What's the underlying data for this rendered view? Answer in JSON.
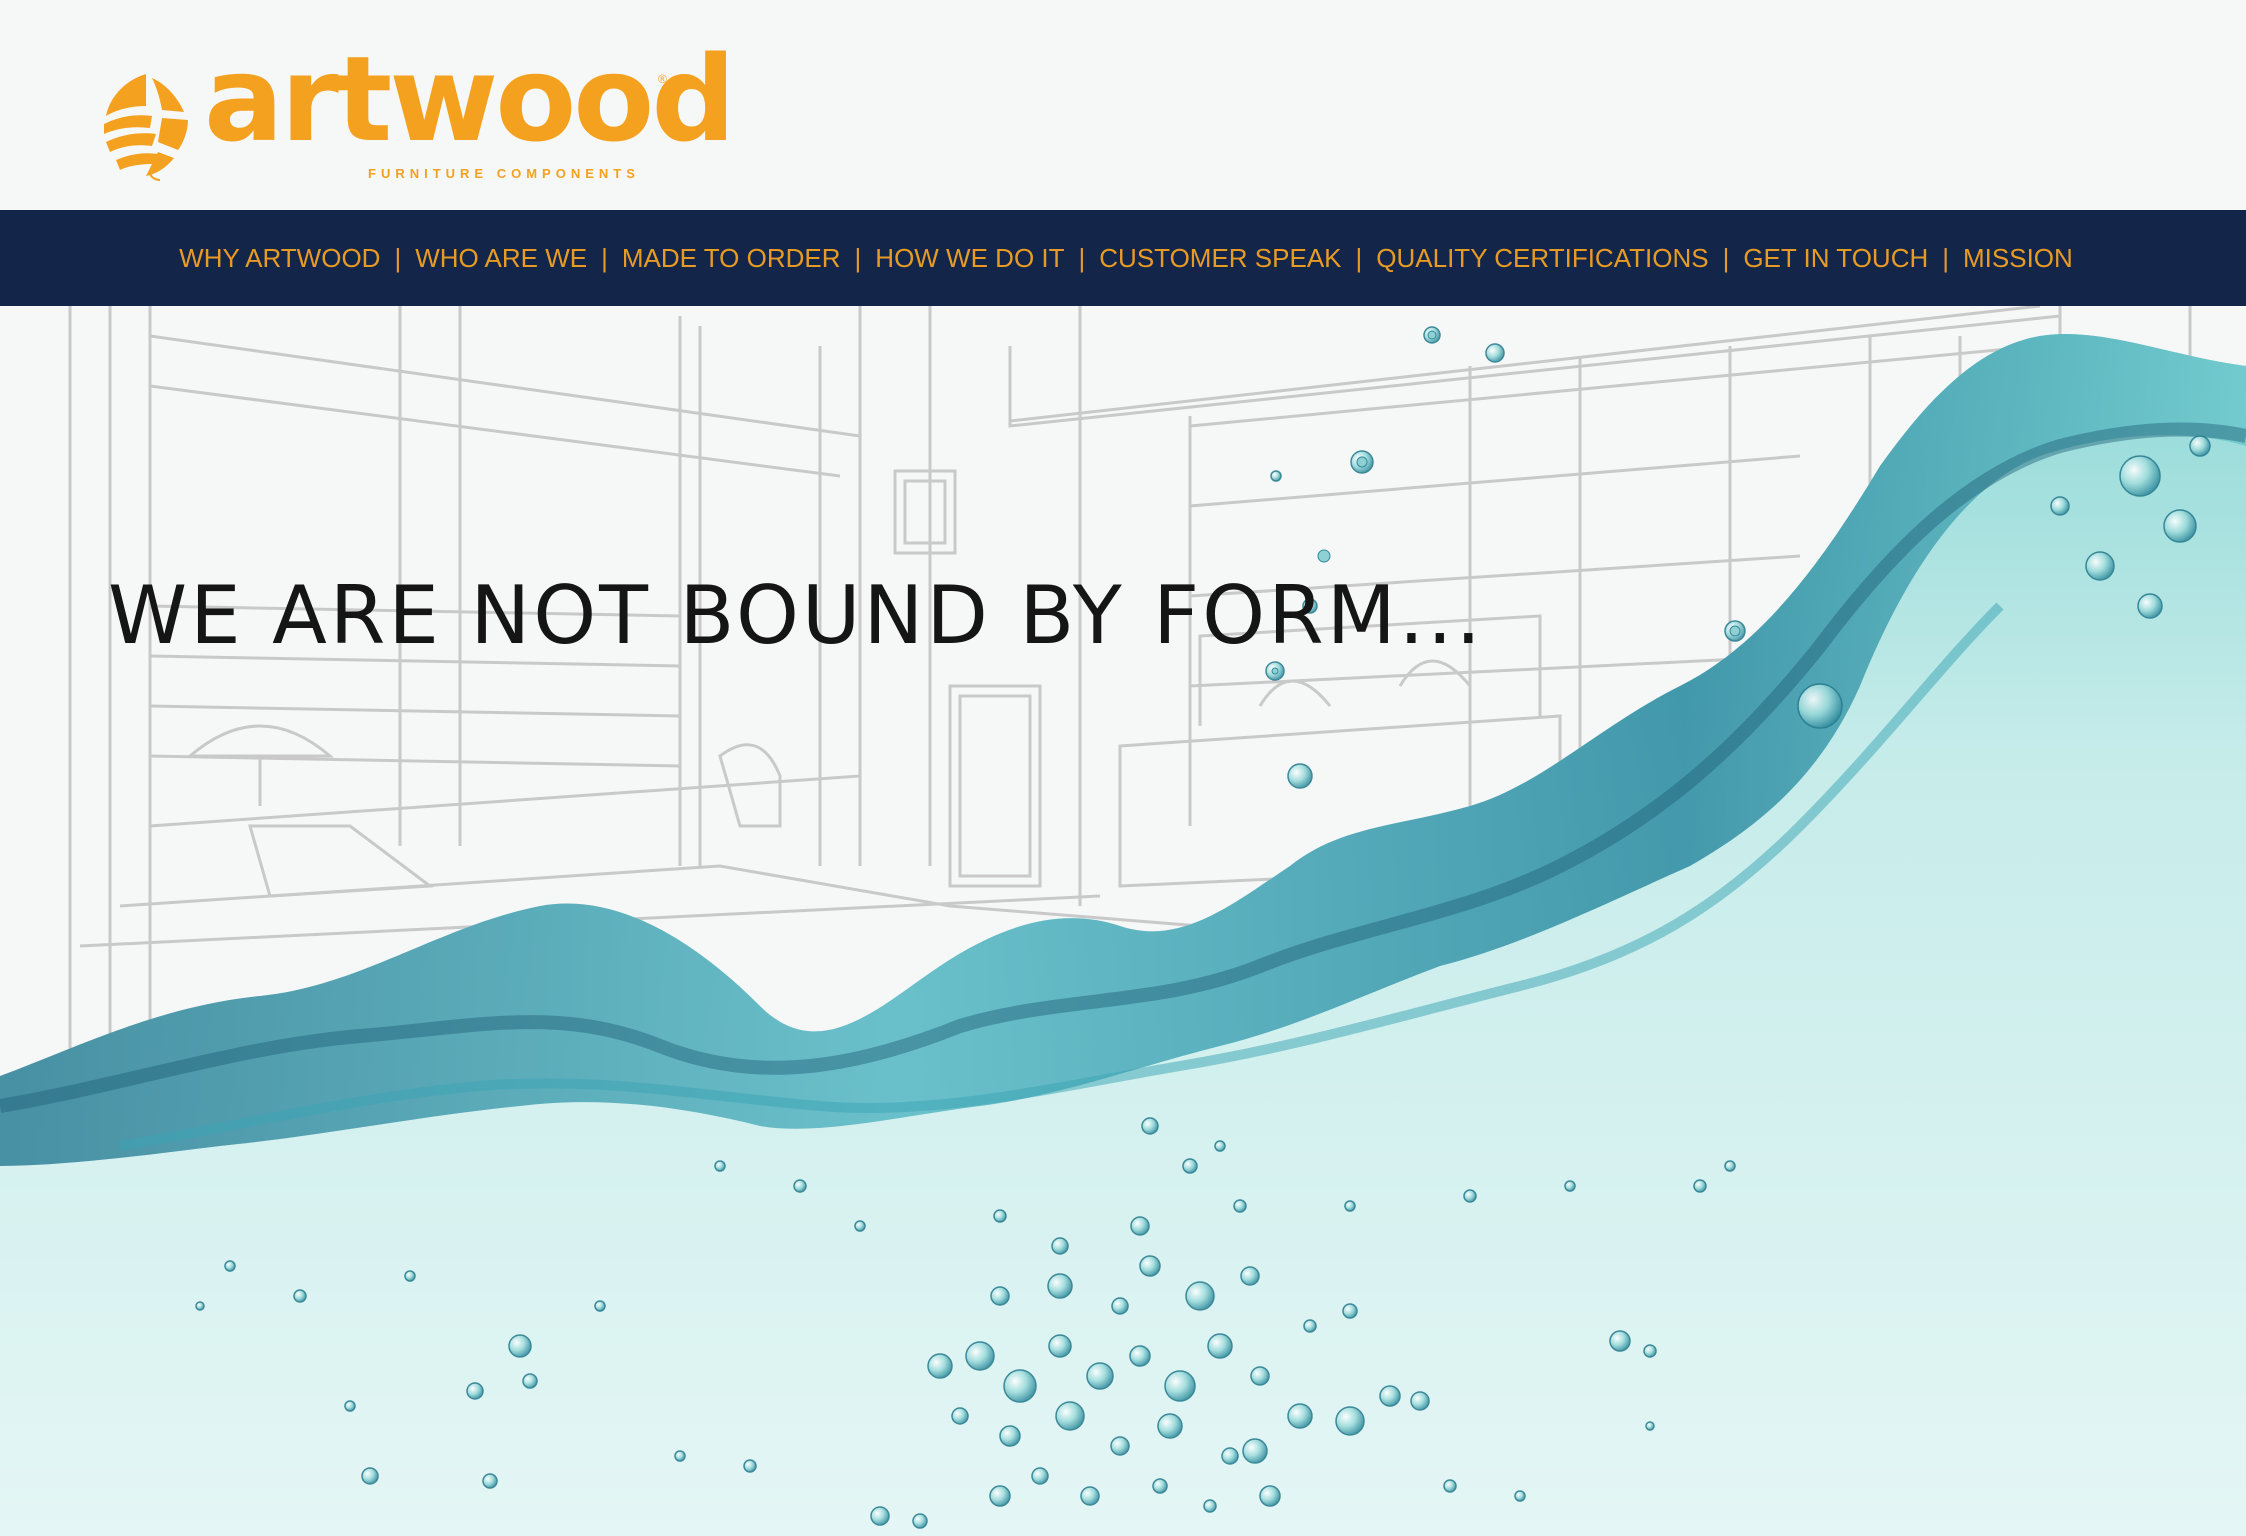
{
  "brand": {
    "name": "artwood",
    "registered_mark": "®",
    "tagline": "FURNITURE COMPONENTS",
    "color": "#f4a11f"
  },
  "nav": {
    "background": "#13264a",
    "text_color": "#e79b24",
    "separator": "|",
    "items": [
      {
        "label": "WHY ARTWOOD"
      },
      {
        "label": "WHO ARE WE"
      },
      {
        "label": "MADE TO ORDER"
      },
      {
        "label": "HOW WE DO IT"
      },
      {
        "label": "CUSTOMER SPEAK"
      },
      {
        "label": "QUALITY CERTIFICATIONS"
      },
      {
        "label": "GET IN TOUCH"
      },
      {
        "label": "MISSION"
      }
    ]
  },
  "hero": {
    "headline": "WE ARE NOT BOUND BY FORM...",
    "image_description_icon": "water-wave-over-room-sketch"
  }
}
